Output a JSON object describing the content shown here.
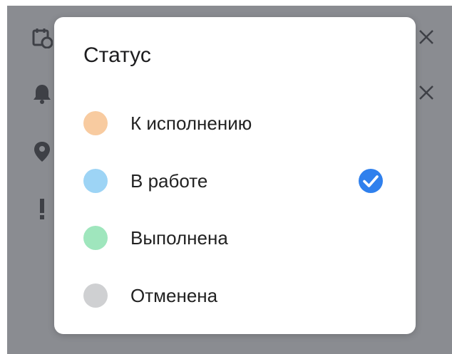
{
  "dialog": {
    "title": "Статус",
    "options": [
      {
        "label": "К исполнению",
        "color": "#f8cba0",
        "selected": false
      },
      {
        "label": "В работе",
        "color": "#9dd4f5",
        "selected": true
      },
      {
        "label": "Выполнена",
        "color": "#9fe6bd",
        "selected": false
      },
      {
        "label": "Отменена",
        "color": "#cfd0d2",
        "selected": false
      }
    ],
    "check_color": "#2f80ed"
  },
  "background": {
    "overlay_color": "#8a8c91",
    "icons": [
      "calendar-clock-icon",
      "bell-icon",
      "location-pin-icon",
      "exclamation-icon"
    ],
    "close_icons": [
      "close-icon",
      "close-icon"
    ]
  }
}
